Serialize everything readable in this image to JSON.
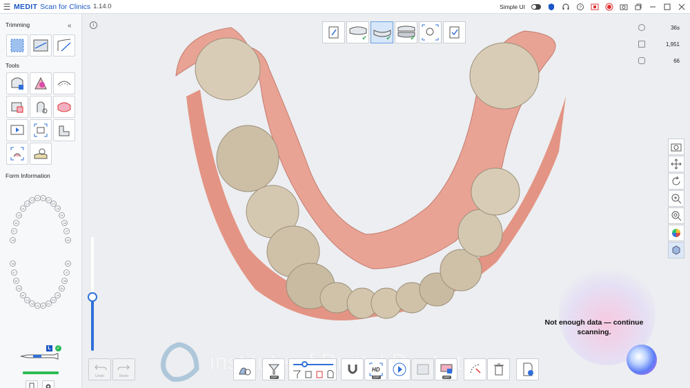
{
  "titlebar": {
    "brand": "MEDIT",
    "app_name": "Scan for Clinics",
    "version": "1.14.0",
    "simple_ui_label": "Simple UI",
    "icons": [
      "info-shield-icon",
      "headset-icon",
      "help-icon",
      "record-stop-icon",
      "record-icon",
      "camera-icon",
      "window-restore-icon",
      "minimize-icon",
      "maximize-icon",
      "close-icon"
    ]
  },
  "left_panel": {
    "trimming_title": "Trimming",
    "collapse_glyph": "«",
    "tools_title": "Tools",
    "form_info_title": "Form Information",
    "scanner_badge": "L",
    "tooth_numbers_upper": [
      "18",
      "17",
      "16",
      "15",
      "14",
      "13",
      "12",
      "11",
      "21",
      "22",
      "23",
      "24",
      "25",
      "26",
      "27",
      "28"
    ],
    "tooth_numbers_lower": [
      "48",
      "47",
      "46",
      "45",
      "44",
      "43",
      "42",
      "41",
      "31",
      "32",
      "33",
      "34",
      "35",
      "36",
      "37",
      "38"
    ]
  },
  "viewport": {
    "info_glyph": "i",
    "stats": [
      {
        "icon": "clock-icon",
        "value": "36s"
      },
      {
        "icon": "layers-icon",
        "value": "1,951"
      },
      {
        "icon": "frames-icon",
        "value": "66"
      }
    ],
    "message": "Not enough data — continue scanning.",
    "watermark": "institute of Digital Dentistry"
  },
  "bottom_bar": {
    "undo_label": "Undo",
    "redo_label": "Redo",
    "off_label": "OFF",
    "hd_label": "HD"
  },
  "colors": {
    "accent": "#2f6fd9",
    "status_green": "#2dbb54",
    "selected_step": "#d7e6f8",
    "gum": "#e89a8c",
    "tooth": "#d9cdb8"
  }
}
